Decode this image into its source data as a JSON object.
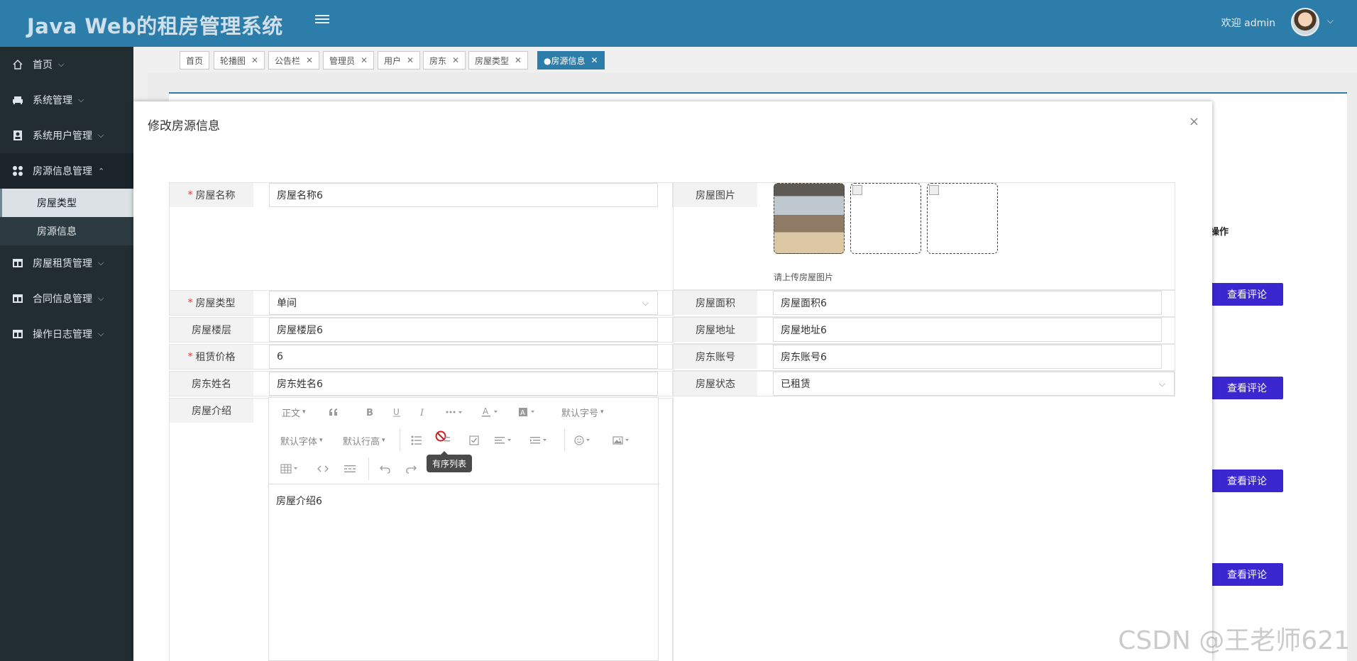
{
  "header": {
    "app_title": "Java Web的租房管理系统",
    "welcome": "欢迎 admin",
    "avatar_chevron": "⌵"
  },
  "sidebar": {
    "items": [
      {
        "label": "首页",
        "icon": "home-icon",
        "chevron": "⌵"
      },
      {
        "label": "系统管理",
        "icon": "sofa-icon",
        "chevron": "⌵"
      },
      {
        "label": "系统用户管理",
        "icon": "contact-card-icon",
        "chevron": "⌵"
      },
      {
        "label": "房源信息管理",
        "icon": "grid-icon",
        "chevron": "⌃"
      },
      {
        "label": "房屋租赁管理",
        "icon": "table-icon",
        "chevron": "⌵"
      },
      {
        "label": "合同信息管理",
        "icon": "table-icon",
        "chevron": "⌵"
      },
      {
        "label": "操作日志管理",
        "icon": "table-icon",
        "chevron": "⌵"
      }
    ],
    "sub_items": [
      {
        "label": "房屋类型"
      },
      {
        "label": "房源信息"
      }
    ]
  },
  "tabs": [
    {
      "label": "首页",
      "close": ""
    },
    {
      "label": "轮播图",
      "close": "✕"
    },
    {
      "label": "公告栏",
      "close": "✕"
    },
    {
      "label": "管理员",
      "close": "✕"
    },
    {
      "label": "用户",
      "close": "✕"
    },
    {
      "label": "房东",
      "close": "✕"
    },
    {
      "label": "房屋类型",
      "close": "✕"
    },
    {
      "label": "●房源信息",
      "close": "✕"
    }
  ],
  "background_list": {
    "op_header": "操作",
    "view_button": "查看评论"
  },
  "modal": {
    "title": "修改房源信息",
    "close": "×",
    "fields": {
      "name": {
        "label": "房屋名称",
        "value": "房屋名称6",
        "required": "*"
      },
      "image": {
        "label": "房屋图片",
        "hint": "请上传房屋图片"
      },
      "type": {
        "label": "房屋类型",
        "value": "单间",
        "required": "*"
      },
      "area": {
        "label": "房屋面积",
        "value": "房屋面积6"
      },
      "floor": {
        "label": "房屋楼层",
        "value": "房屋楼层6"
      },
      "address": {
        "label": "房屋地址",
        "value": "房屋地址6"
      },
      "price": {
        "label": "租赁价格",
        "value": "6",
        "required": "*"
      },
      "landlord_account": {
        "label": "房东账号",
        "value": "房东账号6"
      },
      "landlord_name": {
        "label": "房东姓名",
        "value": "房东姓名6"
      },
      "status": {
        "label": "房屋状态",
        "value": "已租赁"
      },
      "intro": {
        "label": "房屋介绍",
        "value": "房屋介绍6"
      }
    },
    "editor": {
      "heading": "正文",
      "font_size": "默认字号",
      "font_family": "默认字体",
      "line_height": "默认行高",
      "tooltip": "有序列表"
    },
    "chevron": "⌵"
  },
  "watermark": "CSDN @王老师621"
}
